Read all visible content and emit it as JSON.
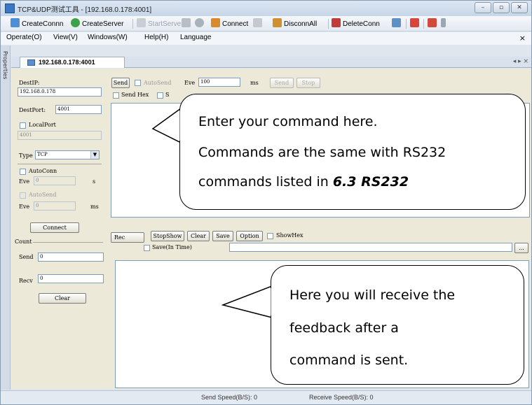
{
  "window": {
    "title": "TCP&UDP测试工具 - [192.168.0.178:4001]",
    "controls": {
      "minimize": "–",
      "maximize": "▫",
      "close": "✕"
    }
  },
  "toolbar": {
    "items": [
      {
        "label": "CreateConnn",
        "icon": "create-conn-icon",
        "enabled": true
      },
      {
        "label": "CreateServer",
        "icon": "create-server-icon",
        "enabled": true
      },
      {
        "label": "StartServer",
        "icon": "start-server-icon",
        "enabled": false
      },
      {
        "label": "Connect",
        "icon": "connect-icon",
        "enabled": true
      },
      {
        "label": "DisconnAll",
        "icon": "disconnect-all-icon",
        "enabled": true
      },
      {
        "label": "DeleteConn",
        "icon": "delete-conn-icon",
        "enabled": true
      }
    ]
  },
  "menubar": {
    "items": [
      "Operate(O)",
      "View(V)",
      "Windows(W)",
      "Help(H)",
      "Language"
    ],
    "close": "×"
  },
  "sidebar": {
    "properties_label": "Properties"
  },
  "tabs": {
    "active": "192.168.0.178:4001",
    "nav": "◂ ▸ ×"
  },
  "left_panel": {
    "dest_ip_label": "DestIP:",
    "dest_ip_value": "192.168.0.178",
    "dest_port_label": "DestPort:",
    "dest_port_value": "4001",
    "local_port_label": "LocalPort",
    "local_port_value": "4001",
    "type_label": "Type",
    "type_value": "TCP",
    "auto_conn_label": "AutoConn",
    "auto_conn_every_label": "Eve",
    "auto_conn_every_value": "0",
    "auto_conn_unit": "s",
    "auto_send_label": "AutoSend",
    "auto_send_every_label": "Eve",
    "auto_send_every_value": "0",
    "auto_send_unit": "ms",
    "connect_button": "Connect",
    "count_label": "Count",
    "send_label": "Send",
    "send_value": "0",
    "recv_label": "Recv",
    "recv_value": "0",
    "clear_button": "Clear"
  },
  "send_panel": {
    "send_button": "Send",
    "auto_send_label": "AutoSend",
    "every_label": "Eve",
    "every_value": "100",
    "unit": "ms",
    "send_btn2": "Send",
    "stop_btn": "Stop",
    "send_hex_label": "Send Hex",
    "extra_label": "S"
  },
  "recv_panel": {
    "label": "Rec",
    "stop_show": "StopShow",
    "clear": "Clear",
    "save": "Save",
    "option": "Option",
    "show_hex": "ShowHex",
    "save_in_time": "Save(In Time)",
    "browse": "..."
  },
  "callouts": {
    "send": {
      "line1": "Enter your command here.",
      "line2": "Commands are the same with RS232",
      "line3_prefix": "commands listed in ",
      "line3_ref": "6.3 RS232"
    },
    "recv": {
      "line1": "Here you will receive the",
      "line2": "feedback after a",
      "line3": "command is sent."
    }
  },
  "statusbar": {
    "send_speed": "Send Speed(B/S): 0",
    "receive_speed": "Receive Speed(B/S): 0"
  },
  "colors": {
    "window_frame": "#dfe6ee",
    "panel": "#ece9d8",
    "input_border": "#7f9db9"
  }
}
